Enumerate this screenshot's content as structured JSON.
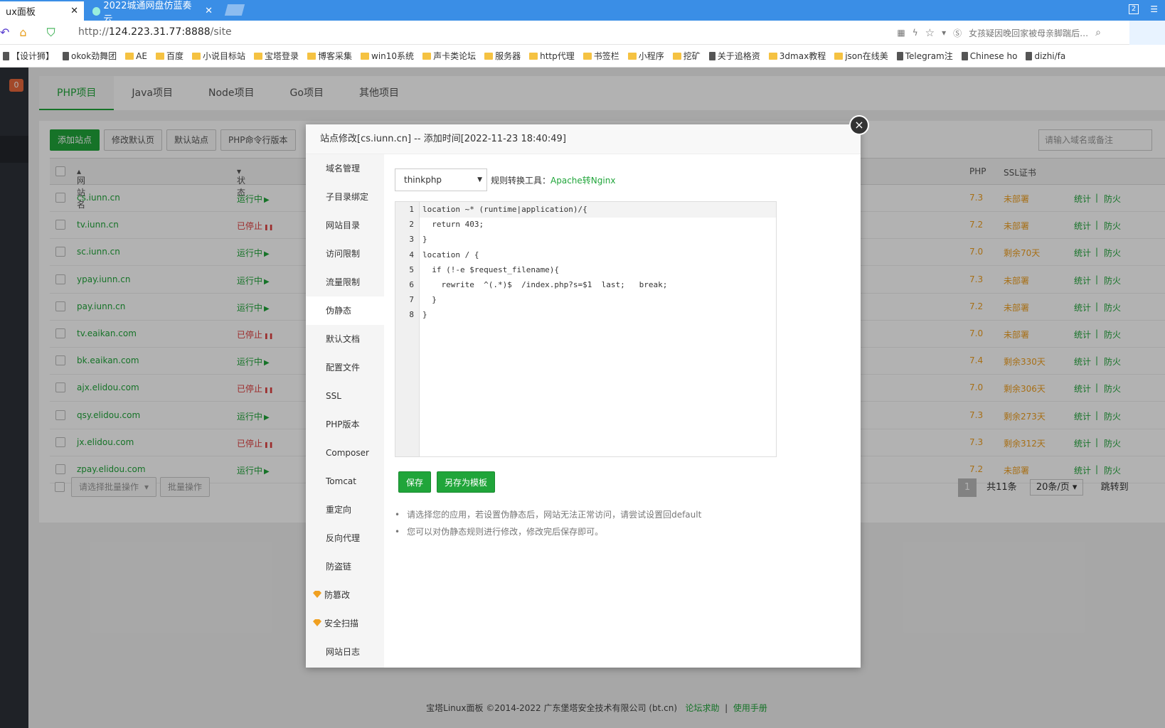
{
  "browser": {
    "tabs": [
      {
        "title": "ux面板",
        "close": "✕"
      },
      {
        "title": "2022城通网盘仿蓝奏云…",
        "close": "✕"
      }
    ],
    "tab_count": "2",
    "url_prefix": "http://",
    "url_host": "124.223.31.77:8888",
    "url_path": "/site",
    "search_hint": "女孩疑因晚回家被母亲脚踹后…",
    "bookmarks": [
      {
        "label": "【设计狮】",
        "type": "page"
      },
      {
        "label": "okok劲舞团",
        "type": "page"
      },
      {
        "label": "AE",
        "type": "folder"
      },
      {
        "label": "百度",
        "type": "folder"
      },
      {
        "label": "小说目标站",
        "type": "folder"
      },
      {
        "label": "宝塔登录",
        "type": "folder"
      },
      {
        "label": "博客采集",
        "type": "folder"
      },
      {
        "label": "win10系统",
        "type": "folder"
      },
      {
        "label": "声卡类论坛",
        "type": "folder"
      },
      {
        "label": "服务器",
        "type": "folder"
      },
      {
        "label": "http代理",
        "type": "folder"
      },
      {
        "label": "书签栏",
        "type": "folder"
      },
      {
        "label": "小程序",
        "type": "folder"
      },
      {
        "label": "挖矿",
        "type": "folder"
      },
      {
        "label": "关于追格资",
        "type": "page"
      },
      {
        "label": "3dmax教程",
        "type": "folder"
      },
      {
        "label": "json在线美",
        "type": "folder"
      },
      {
        "label": "Telegram注",
        "type": "page"
      },
      {
        "label": "Chinese ho",
        "type": "page"
      },
      {
        "label": "dizhi/fa",
        "type": "page"
      }
    ]
  },
  "app": {
    "notify_count": "0",
    "project_tabs": [
      "PHP项目",
      "Java项目",
      "Node项目",
      "Go项目",
      "其他项目"
    ],
    "toolbar": [
      "添加站点",
      "修改默认页",
      "默认站点",
      "PHP命令行版本"
    ],
    "search_placeholder": "请输入域名或备注",
    "columns": {
      "name": "网站名",
      "status": "状态",
      "php": "PHP",
      "ssl": "SSL证书"
    },
    "sites": [
      {
        "name": "cs.iunn.cn",
        "status": "运行中",
        "running": true,
        "php": "7.3",
        "ssl": "未部署",
        "stat": "统计",
        "fw": "防火"
      },
      {
        "name": "tv.iunn.cn",
        "status": "已停止",
        "running": false,
        "php": "7.2",
        "ssl": "未部署",
        "stat": "统计",
        "fw": "防火"
      },
      {
        "name": "sc.iunn.cn",
        "status": "运行中",
        "running": true,
        "php": "7.0",
        "ssl": "剩余70天",
        "stat": "统计",
        "fw": "防火"
      },
      {
        "name": "ypay.iunn.cn",
        "status": "运行中",
        "running": true,
        "php": "7.3",
        "ssl": "未部署",
        "stat": "统计",
        "fw": "防火"
      },
      {
        "name": "pay.iunn.cn",
        "status": "运行中",
        "running": true,
        "php": "7.2",
        "ssl": "未部署",
        "stat": "统计",
        "fw": "防火"
      },
      {
        "name": "tv.eaikan.com",
        "status": "已停止",
        "running": false,
        "php": "7.0",
        "ssl": "未部署",
        "stat": "统计",
        "fw": "防火"
      },
      {
        "name": "bk.eaikan.com",
        "status": "运行中",
        "running": true,
        "php": "7.4",
        "ssl": "剩余330天",
        "stat": "统计",
        "fw": "防火"
      },
      {
        "name": "ajx.elidou.com",
        "status": "已停止",
        "running": false,
        "php": "7.0",
        "ssl": "剩余306天",
        "stat": "统计",
        "fw": "防火"
      },
      {
        "name": "qsy.elidou.com",
        "status": "运行中",
        "running": true,
        "php": "7.3",
        "ssl": "剩余273天",
        "stat": "统计",
        "fw": "防火"
      },
      {
        "name": "jx.elidou.com",
        "status": "已停止",
        "running": false,
        "php": "7.3",
        "ssl": "剩余312天",
        "stat": "统计",
        "fw": "防火"
      },
      {
        "name": "zpay.elidou.com",
        "status": "运行中",
        "running": true,
        "php": "7.2",
        "ssl": "未部署",
        "stat": "统计",
        "fw": "防火"
      }
    ],
    "batch_placeholder": "请选择批量操作",
    "batch_button": "批量操作",
    "pager": {
      "current": "1",
      "total": "共11条",
      "per_page": "20条/页",
      "jump": "跳转到"
    },
    "footer": {
      "text": "宝塔Linux面板 ©2014-2022 广东堡塔安全技术有限公司 (bt.cn)",
      "forum": "论坛求助",
      "sep": "|",
      "manual": "使用手册"
    }
  },
  "modal": {
    "title": "站点修改[cs.iunn.cn] -- 添加时间[2022-11-23 18:40:49]",
    "menu": [
      "域名管理",
      "子目录绑定",
      "网站目录",
      "访问限制",
      "流量限制",
      "伪静态",
      "默认文档",
      "配置文件",
      "SSL",
      "PHP版本",
      "Composer",
      "Tomcat",
      "重定向",
      "反向代理",
      "防盗链",
      "防篡改",
      "安全扫描",
      "网站日志"
    ],
    "active_menu": "伪静态",
    "selected_template": "thinkphp",
    "tool_label": "规则转换工具：",
    "tool_link": "Apache转Nginx",
    "code_lines": [
      "location ~* (runtime|application)/{",
      "  return 403;",
      "}",
      "location / {",
      "  if (!-e $request_filename){",
      "    rewrite  ^(.*)$  /index.php?s=$1  last;   break;",
      "  }",
      "}"
    ],
    "save_label": "保存",
    "save_template_label": "另存为模板",
    "tips": [
      "请选择您的应用，若设置伪静态后，网站无法正常访问，请尝试设置回default",
      "您可以对伪静态规则进行修改，修改完后保存即可。"
    ],
    "close_symbol": "×"
  }
}
